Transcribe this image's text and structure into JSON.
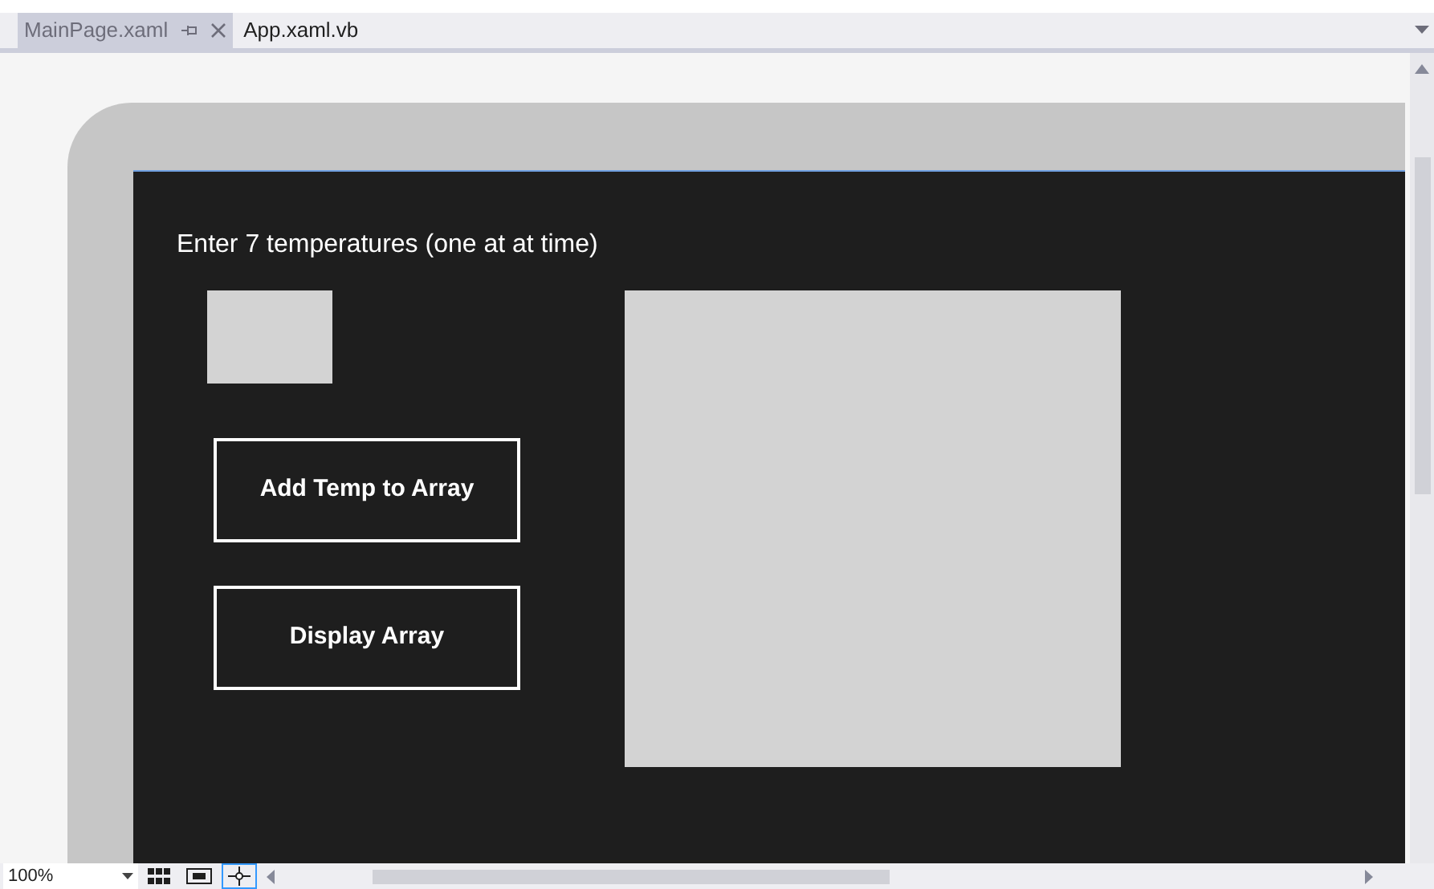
{
  "tabs": [
    {
      "label": "MainPage.xaml",
      "selected": true,
      "pinned": true,
      "closable": true
    },
    {
      "label": "App.xaml.vb",
      "selected": false,
      "pinned": false,
      "closable": false
    }
  ],
  "canvas": {
    "prompt": "Enter 7 temperatures (one at at time)",
    "buttons": [
      "Add Temp to Array",
      "Display Array"
    ]
  },
  "status_bar": {
    "zoom": "100%"
  }
}
